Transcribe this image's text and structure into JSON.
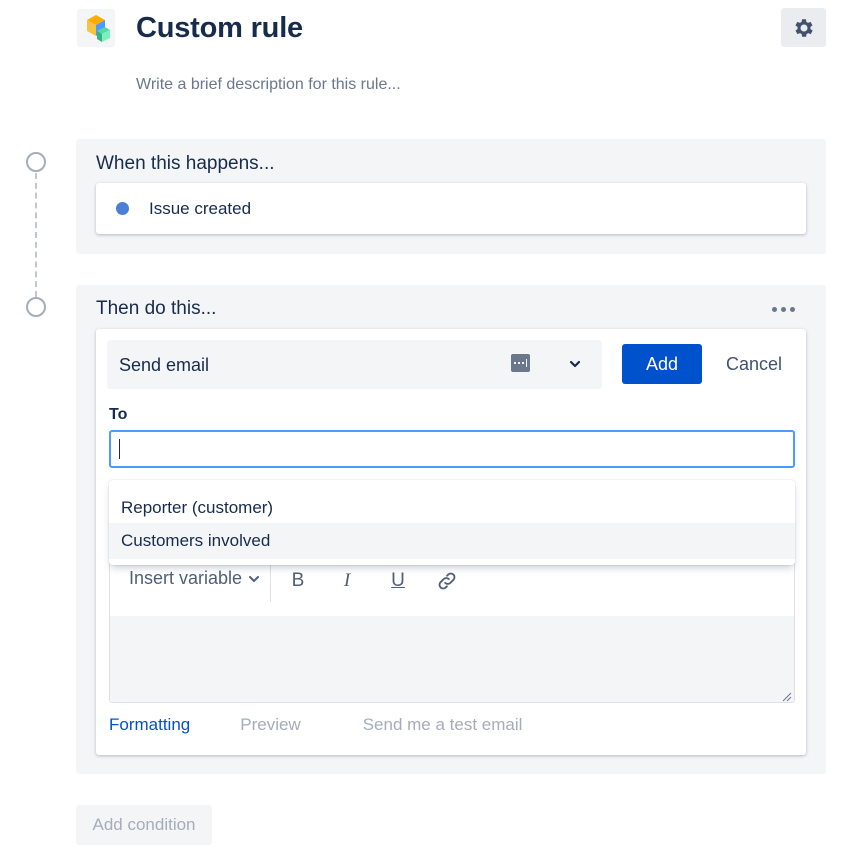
{
  "header": {
    "title": "Custom rule",
    "description_placeholder": "Write a brief description for this rule..."
  },
  "trigger": {
    "heading": "When this happens...",
    "item_label": "Issue created",
    "dot_color": "#4b7fd6"
  },
  "action": {
    "heading": "Then do this...",
    "selected": "Send email",
    "add_label": "Add",
    "cancel_label": "Cancel",
    "to_label": "To",
    "to_value": "",
    "suggestions": [
      "Reporter (customer)",
      "Customers involved"
    ],
    "toolbar": {
      "insert_variable": "Insert variable",
      "bold": "B",
      "italic": "I",
      "underline": "U"
    },
    "tabs": {
      "formatting": "Formatting",
      "preview": "Preview",
      "test_email": "Send me a test email"
    }
  },
  "footer": {
    "add_condition": "Add condition"
  },
  "colors": {
    "primary": "#0052cc",
    "focus": "#4c9aff",
    "panel_bg": "#f4f5f7"
  }
}
